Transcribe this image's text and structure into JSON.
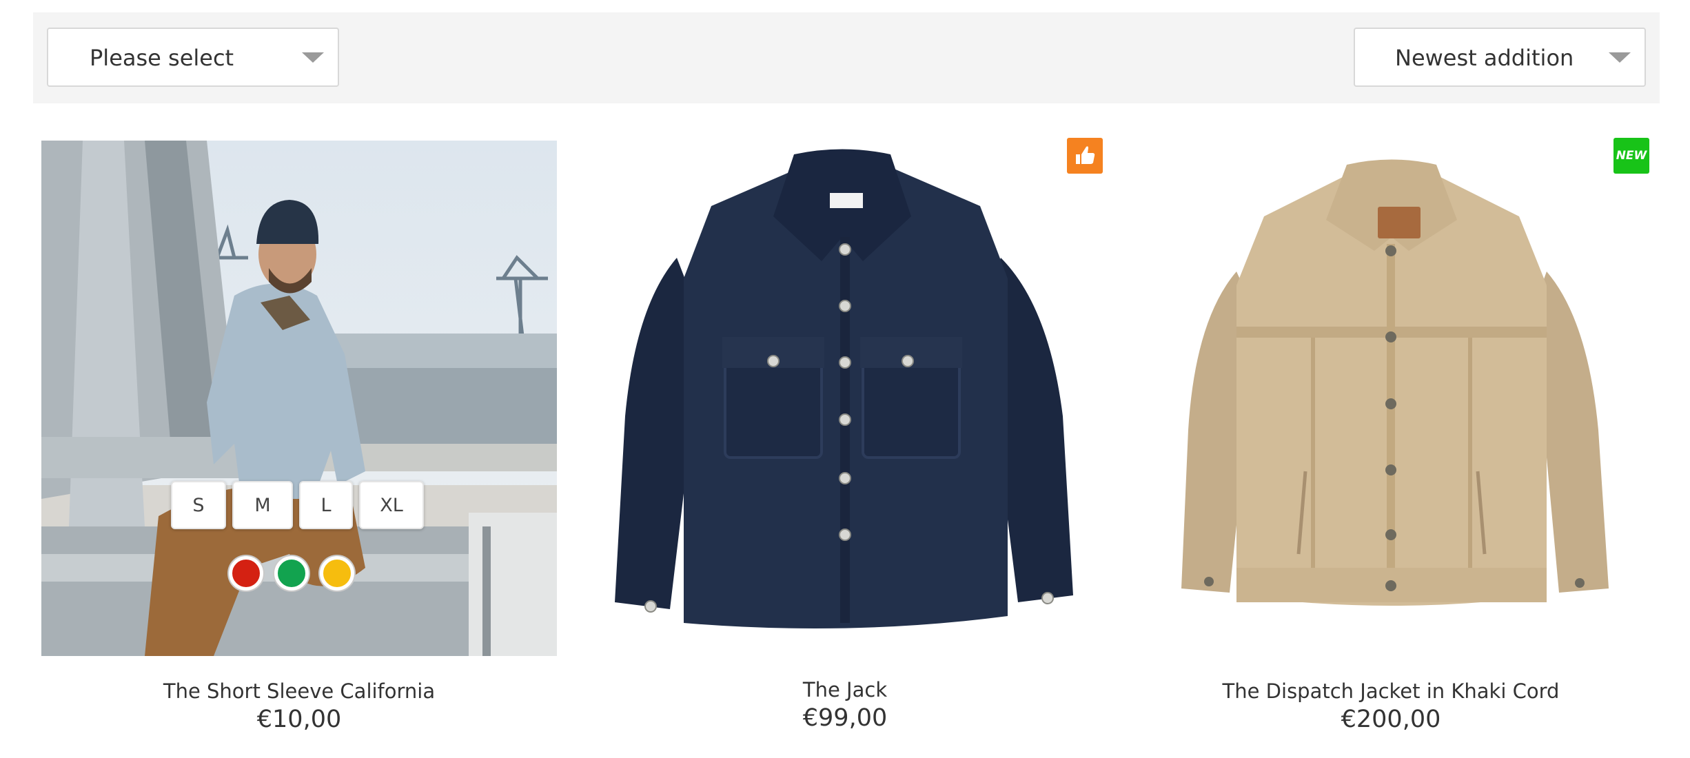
{
  "filters": {
    "category_select": {
      "value": "Please select"
    },
    "sort_select": {
      "value": "Newest addition"
    }
  },
  "products": [
    {
      "name": "The Short Sleeve California",
      "price": "€10,00",
      "sizes": [
        "S",
        "M",
        "L",
        "XL"
      ],
      "colors": [
        "#d42112",
        "#12a34f",
        "#f6bd0e"
      ]
    },
    {
      "name": "The Jack",
      "price": "€99,00",
      "badge_icon": "thumbs-up-icon"
    },
    {
      "name": "The Dispatch Jacket in Khaki Cord",
      "price": "€200,00",
      "badge": "NEW"
    }
  ],
  "colors": {
    "bar_bg": "#f4f4f4",
    "badge_like": "#f58220",
    "badge_new": "#18c318"
  }
}
